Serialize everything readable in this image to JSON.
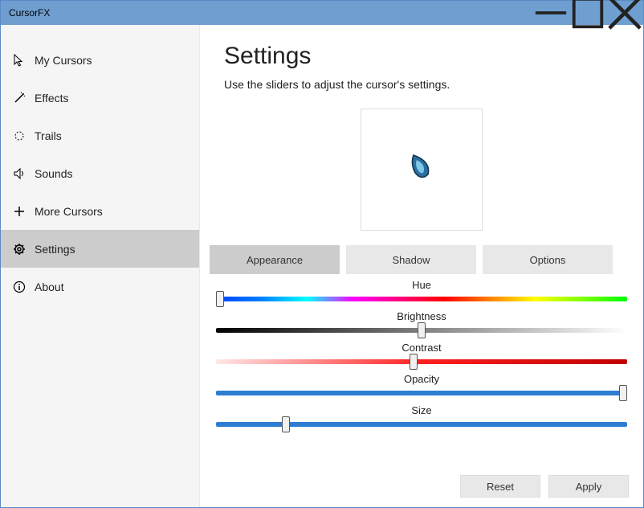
{
  "window": {
    "title": "CursorFX"
  },
  "sidebar": {
    "items": [
      {
        "label": "My Cursors"
      },
      {
        "label": "Effects"
      },
      {
        "label": "Trails"
      },
      {
        "label": "Sounds"
      },
      {
        "label": "More Cursors"
      },
      {
        "label": "Settings"
      },
      {
        "label": "About"
      }
    ]
  },
  "main": {
    "title": "Settings",
    "subtitle": "Use the sliders to adjust the cursor's settings."
  },
  "tabs": {
    "appearance": "Appearance",
    "shadow": "Shadow",
    "options": "Options"
  },
  "sliders": {
    "hue": {
      "label": "Hue",
      "value_pct": 1
    },
    "brightness": {
      "label": "Brightness",
      "value_pct": 50
    },
    "contrast": {
      "label": "Contrast",
      "value_pct": 48
    },
    "opacity": {
      "label": "Opacity",
      "value_pct": 99
    },
    "size": {
      "label": "Size",
      "value_pct": 17
    }
  },
  "buttons": {
    "reset": "Reset",
    "apply": "Apply"
  }
}
